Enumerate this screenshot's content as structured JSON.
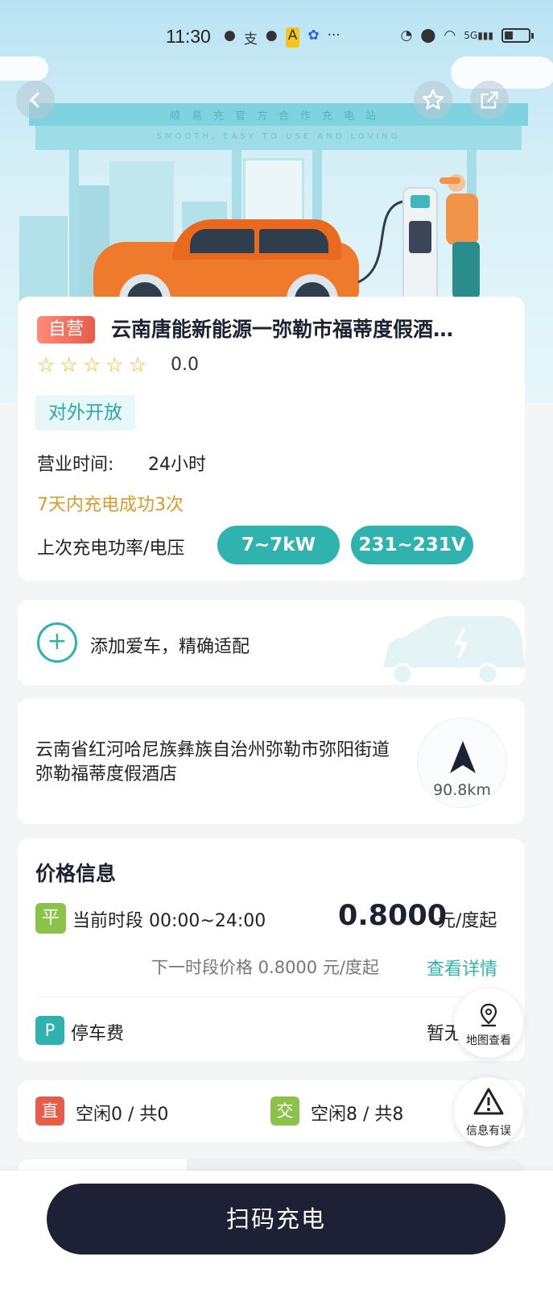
{
  "status_bar": {
    "time": "11:30",
    "notification_icons": [
      "wechat-icon",
      "alipay-icon",
      "message-icon",
      "app-icon",
      "baidu-icon",
      "more-icon"
    ],
    "network": "5G"
  },
  "header": {
    "banner_title": "顺易充官方合作充电站",
    "banner_subtitle": "SMOOTH, EASY TO USE AND LOVING",
    "back_icon": "back-icon",
    "favorite_icon": "star-outline-icon",
    "share_icon": "share-icon"
  },
  "station": {
    "tag": "自营",
    "title": "云南唐能新能源一弥勒市福蒂度假酒…",
    "rating": "0.0",
    "stars": 0,
    "open_status": "对外开放",
    "hours_label": "营业时间:",
    "hours_value": "24小时",
    "success_text": "7天内充电成功3次",
    "power_label": "上次充电功率/电压",
    "power_value": "7~7kW",
    "voltage_value": "231~231V"
  },
  "add_car": {
    "text": "添加爱车，精确适配"
  },
  "location": {
    "address": "云南省红河哈尼族彝族自治州弥勒市弥阳街道弥勒福蒂度假酒店",
    "distance": "90.8km"
  },
  "price": {
    "section_title": "价格信息",
    "period_badge": "平",
    "period_text": "当前时段 00:00~24:00",
    "current_price": "0.8000",
    "price_unit": "元/度起",
    "next_price_text": "下一时段价格 0.8000 元/度起",
    "detail_link": "查看详情",
    "parking_badge": "P",
    "parking_label": "停车费",
    "parking_value": "暂无"
  },
  "chargers": {
    "dc_badge": "直",
    "dc_text": "空闲0 / 共0",
    "ac_badge": "交",
    "ac_text": "空闲8 / 共8"
  },
  "floating": {
    "map_label": "地图查看",
    "report_label": "信息有误"
  },
  "bottom": {
    "scan_button": "扫码充电"
  },
  "colors": {
    "accent": "#30b2ae",
    "dark": "#1e2136",
    "warning": "#d99a2b",
    "self_tag": "#e85c4a"
  }
}
